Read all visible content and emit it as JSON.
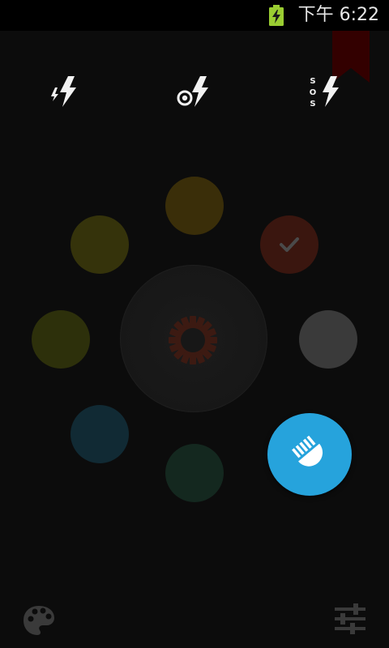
{
  "status_bar": {
    "time": "下午 6:22",
    "battery_icon": "battery-charging-icon"
  },
  "modes": [
    {
      "name": "flash",
      "icon": "flash-icon"
    },
    {
      "name": "strobe",
      "icon": "strobe-flash-icon"
    },
    {
      "name": "sos",
      "icon": "sos-flash-icon",
      "label": "SOS"
    }
  ],
  "color_wheel": {
    "colors": [
      {
        "name": "orange",
        "hex": "#3a2e09"
      },
      {
        "name": "red",
        "hex": "#3a160f",
        "selected": true
      },
      {
        "name": "white",
        "hex": "#3a3a3a"
      },
      {
        "name": "green",
        "hex": "#14281f"
      },
      {
        "name": "blue",
        "hex": "#112a34"
      },
      {
        "name": "yellow-green",
        "hex": "#2d300b"
      },
      {
        "name": "yellow",
        "hex": "#35330b"
      }
    ],
    "center_icon": "gear-icon",
    "torch_button_color": "#26a3dc"
  },
  "bottom_bar": {
    "left_icon": "palette-icon",
    "right_icon": "sliders-icon"
  },
  "colors": {
    "background": "#0c0c0c",
    "accent": "#26a3dc",
    "bookmark": "#330000"
  }
}
